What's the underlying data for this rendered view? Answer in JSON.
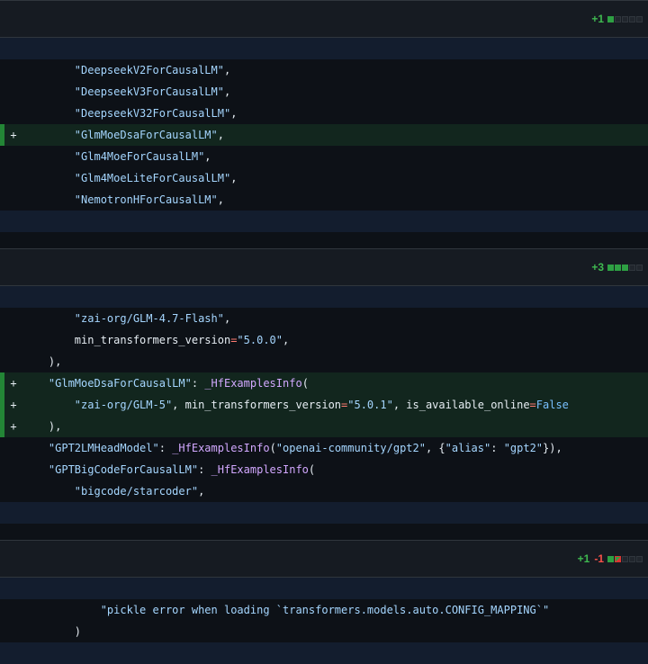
{
  "files": [
    {
      "stats": {
        "add": "+1",
        "del": "",
        "squares": [
          "add",
          "neutral",
          "neutral",
          "neutral",
          "neutral"
        ]
      },
      "lines": [
        {
          "type": "ctx",
          "marker": "",
          "indent": "        ",
          "tokens": [
            {
              "c": "s",
              "t": "\"DeepseekV2ForCausalLM\""
            },
            {
              "c": "",
              "t": ","
            }
          ]
        },
        {
          "type": "ctx",
          "marker": "",
          "indent": "        ",
          "tokens": [
            {
              "c": "s",
              "t": "\"DeepseekV3ForCausalLM\""
            },
            {
              "c": "",
              "t": ","
            }
          ]
        },
        {
          "type": "ctx",
          "marker": "",
          "indent": "        ",
          "tokens": [
            {
              "c": "s",
              "t": "\"DeepseekV32ForCausalLM\""
            },
            {
              "c": "",
              "t": ","
            }
          ]
        },
        {
          "type": "add",
          "marker": "+",
          "indent": "        ",
          "tokens": [
            {
              "c": "s",
              "t": "\"GlmMoeDsaForCausalLM\""
            },
            {
              "c": "",
              "t": ","
            }
          ]
        },
        {
          "type": "ctx",
          "marker": "",
          "indent": "        ",
          "tokens": [
            {
              "c": "s",
              "t": "\"Glm4MoeForCausalLM\""
            },
            {
              "c": "",
              "t": ","
            }
          ]
        },
        {
          "type": "ctx",
          "marker": "",
          "indent": "        ",
          "tokens": [
            {
              "c": "s",
              "t": "\"Glm4MoeLiteForCausalLM\""
            },
            {
              "c": "",
              "t": ","
            }
          ]
        },
        {
          "type": "ctx",
          "marker": "",
          "indent": "        ",
          "tokens": [
            {
              "c": "s",
              "t": "\"NemotronHForCausalLM\""
            },
            {
              "c": "",
              "t": ","
            }
          ]
        }
      ]
    },
    {
      "stats": {
        "add": "+3",
        "del": "",
        "squares": [
          "add",
          "add",
          "add",
          "neutral",
          "neutral"
        ]
      },
      "lines": [
        {
          "type": "ctx",
          "marker": "",
          "indent": "        ",
          "tokens": [
            {
              "c": "s",
              "t": "\"zai-org/GLM-4.7-Flash\""
            },
            {
              "c": "",
              "t": ","
            }
          ]
        },
        {
          "type": "ctx",
          "marker": "",
          "indent": "        ",
          "tokens": [
            {
              "c": "",
              "t": "min_transformers_version"
            },
            {
              "c": "o",
              "t": "="
            },
            {
              "c": "s",
              "t": "\"5.0.0\""
            },
            {
              "c": "",
              "t": ","
            }
          ]
        },
        {
          "type": "ctx",
          "marker": "",
          "indent": "    ",
          "tokens": [
            {
              "c": "",
              "t": "),"
            }
          ]
        },
        {
          "type": "add",
          "marker": "+",
          "indent": "    ",
          "tokens": [
            {
              "c": "s",
              "t": "\"GlmMoeDsaForCausalLM\""
            },
            {
              "c": "",
              "t": ": "
            },
            {
              "c": "n",
              "t": "_HfExamplesInfo"
            },
            {
              "c": "",
              "t": "("
            }
          ]
        },
        {
          "type": "add",
          "marker": "+",
          "indent": "        ",
          "tokens": [
            {
              "c": "s",
              "t": "\"zai-org/GLM-5\""
            },
            {
              "c": "",
              "t": ", min_transformers_version"
            },
            {
              "c": "o",
              "t": "="
            },
            {
              "c": "s",
              "t": "\"5.0.1\""
            },
            {
              "c": "",
              "t": ", is_available_online"
            },
            {
              "c": "o",
              "t": "="
            },
            {
              "c": "k",
              "t": "False"
            }
          ]
        },
        {
          "type": "add",
          "marker": "+",
          "indent": "    ",
          "tokens": [
            {
              "c": "",
              "t": "),"
            }
          ]
        },
        {
          "type": "ctx",
          "marker": "",
          "indent": "    ",
          "tokens": [
            {
              "c": "s",
              "t": "\"GPT2LMHeadModel\""
            },
            {
              "c": "",
              "t": ": "
            },
            {
              "c": "n",
              "t": "_HfExamplesInfo"
            },
            {
              "c": "",
              "t": "("
            },
            {
              "c": "s",
              "t": "\"openai-community/gpt2\""
            },
            {
              "c": "",
              "t": ", {"
            },
            {
              "c": "s",
              "t": "\"alias\""
            },
            {
              "c": "",
              "t": ": "
            },
            {
              "c": "s",
              "t": "\"gpt2\""
            },
            {
              "c": "",
              "t": "}),"
            }
          ]
        },
        {
          "type": "ctx",
          "marker": "",
          "indent": "    ",
          "tokens": [
            {
              "c": "s",
              "t": "\"GPTBigCodeForCausalLM\""
            },
            {
              "c": "",
              "t": ": "
            },
            {
              "c": "n",
              "t": "_HfExamplesInfo"
            },
            {
              "c": "",
              "t": "("
            }
          ]
        },
        {
          "type": "ctx",
          "marker": "",
          "indent": "        ",
          "tokens": [
            {
              "c": "s",
              "t": "\"bigcode/starcoder\""
            },
            {
              "c": "",
              "t": ","
            }
          ]
        }
      ]
    },
    {
      "stats": {
        "add": "+1",
        "del": "-1",
        "squares": [
          "add",
          "mixed",
          "neutral",
          "neutral",
          "neutral"
        ]
      },
      "lines": [
        {
          "type": "ctx",
          "marker": "",
          "indent": "            ",
          "tokens": [
            {
              "c": "s",
              "t": "\"pickle error when loading `transformers.models.auto.CONFIG_MAPPING`\""
            }
          ]
        },
        {
          "type": "ctx",
          "marker": "",
          "indent": "        ",
          "tokens": [
            {
              "c": "",
              "t": ")"
            }
          ]
        }
      ]
    }
  ]
}
